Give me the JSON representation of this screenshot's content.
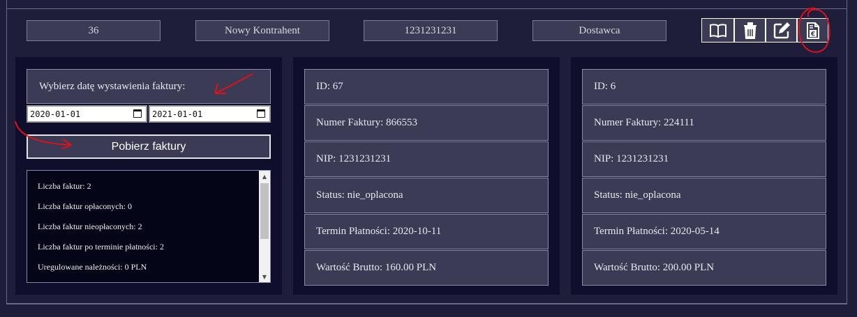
{
  "header": {
    "id_value": "36",
    "name_value": "Nowy Kontrahent",
    "nip_value": "1231231231",
    "type_value": "Dostawca"
  },
  "actions": [
    {
      "icon": "book-icon"
    },
    {
      "icon": "trash-icon"
    },
    {
      "icon": "edit-icon"
    },
    {
      "icon": "invoice-euro-icon"
    }
  ],
  "filter": {
    "title": "Wybierz datę wystawienia faktury:",
    "date_from": "2020-01-01",
    "date_to": "2021-01-01",
    "fetch_label": "Pobierz faktury"
  },
  "stats": [
    "Liczba faktur: 2",
    "Liczba faktur opłaconych: 0",
    "Liczba faktur nieopłaconych: 2",
    "Liczba faktur po terminie płatności: 2",
    "Uregulowane należności: 0 PLN"
  ],
  "invoices": [
    {
      "id": "ID: 67",
      "number": "Numer Faktury: 866553",
      "nip": "NIP: 1231231231",
      "status": "Status: nie_oplacona",
      "due": "Termin Płatności: 2020-10-11",
      "gross": "Wartość Brutto: 160.00 PLN"
    },
    {
      "id": "ID: 6",
      "number": "Numer Faktury: 224111",
      "nip": "NIP: 1231231231",
      "status": "Status: nie_oplacona",
      "due": "Termin Płatności: 2020-05-14",
      "gross": "Wartość Brutto: 200.00 PLN"
    }
  ],
  "colors": {
    "background": "#1e1e3a",
    "panel": "#0f0f2d",
    "field": "#3b3b55",
    "annotation": "#e0101a"
  }
}
